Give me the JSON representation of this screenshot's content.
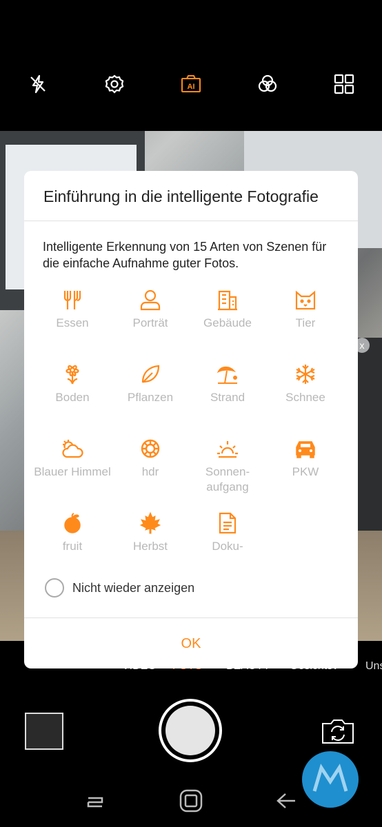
{
  "colors": {
    "accent": "#ff8a1c",
    "label_gray": "#b8b8b8",
    "dialog_bg": "#ffffff"
  },
  "toolbar": {
    "icons": [
      "flash-off-icon",
      "settings-icon",
      "ai-scene-icon",
      "filter-icon",
      "grid-icon"
    ]
  },
  "dialog": {
    "title": "Einführung in die intelligente Fotografie",
    "description": "Intelligente Erkennung von 15 Arten von Szenen für die einfache Aufnahme guter Fotos.",
    "scenes": [
      {
        "icon": "food-icon",
        "label": "Essen"
      },
      {
        "icon": "portrait-icon",
        "label": "Porträt"
      },
      {
        "icon": "building-icon",
        "label": "Gebäude"
      },
      {
        "icon": "cat-icon",
        "label": "Tier"
      },
      {
        "icon": "flower-icon",
        "label": "Boden"
      },
      {
        "icon": "leaf-icon",
        "label": "Pflanzen"
      },
      {
        "icon": "beach-icon",
        "label": "Strand"
      },
      {
        "icon": "snowflake-icon",
        "label": "Schnee"
      },
      {
        "icon": "cloudy-icon",
        "label": "Blauer Himmel"
      },
      {
        "icon": "ring-icon",
        "label": "hdr"
      },
      {
        "icon": "sunrise-icon",
        "label": "Sonnen-aufgang"
      },
      {
        "icon": "car-icon",
        "label": "PKW"
      },
      {
        "icon": "fruit-icon",
        "label": "fruit"
      },
      {
        "icon": "maple-leaf-icon",
        "label": "Herbst"
      },
      {
        "icon": "document-icon",
        "label": "Doku-"
      }
    ],
    "dont_show_again": "Nicht wieder anzeigen",
    "ok_label": "OK"
  },
  "modes": [
    "VIDEO",
    "FOTO",
    "BEAUTY",
    "Gesichtsv",
    "Uns"
  ],
  "active_mode": "FOTO"
}
